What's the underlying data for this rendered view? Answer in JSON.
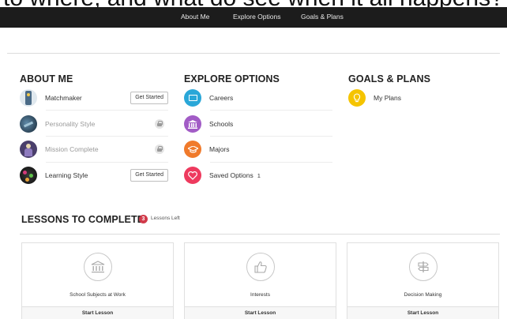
{
  "clipped_text": "to where, and what do see when it all happens?",
  "nav": {
    "about": "About Me",
    "explore": "Explore Options",
    "goals": "Goals & Plans"
  },
  "about_me": {
    "title": "ABOUT ME",
    "items": [
      {
        "label": "Matchmaker",
        "action": "Get Started",
        "locked": false
      },
      {
        "label": "Personality Style",
        "locked": true
      },
      {
        "label": "Mission Complete",
        "locked": true
      },
      {
        "label": "Learning Style",
        "action": "Get Started",
        "locked": false
      }
    ]
  },
  "explore": {
    "title": "EXPLORE OPTIONS",
    "items": [
      {
        "label": "Careers",
        "icon": "briefcase-icon",
        "color": "#2aa7d8"
      },
      {
        "label": "Schools",
        "icon": "school-icon",
        "color": "#a25cc6"
      },
      {
        "label": "Majors",
        "icon": "graduation-cap-icon",
        "color": "#f07a2b"
      },
      {
        "label": "Saved Options",
        "count": "1",
        "icon": "heart-icon",
        "color": "#ee3a5e"
      }
    ]
  },
  "goals": {
    "title": "GOALS & PLANS",
    "items": [
      {
        "label": "My Plans",
        "icon": "lightbulb-icon",
        "color": "#f5c400"
      }
    ]
  },
  "lessons": {
    "title": "LESSONS TO COMPLETE",
    "badge": "3",
    "left_label": "Lessons Left",
    "cards": [
      {
        "title": "School Subjects at Work",
        "action": "Start Lesson",
        "icon": "school-building-icon"
      },
      {
        "title": "Interests",
        "action": "Start Lesson",
        "icon": "thumbs-up-icon"
      },
      {
        "title": "Decision Making",
        "action": "Start Lesson",
        "icon": "signpost-icon"
      }
    ]
  }
}
